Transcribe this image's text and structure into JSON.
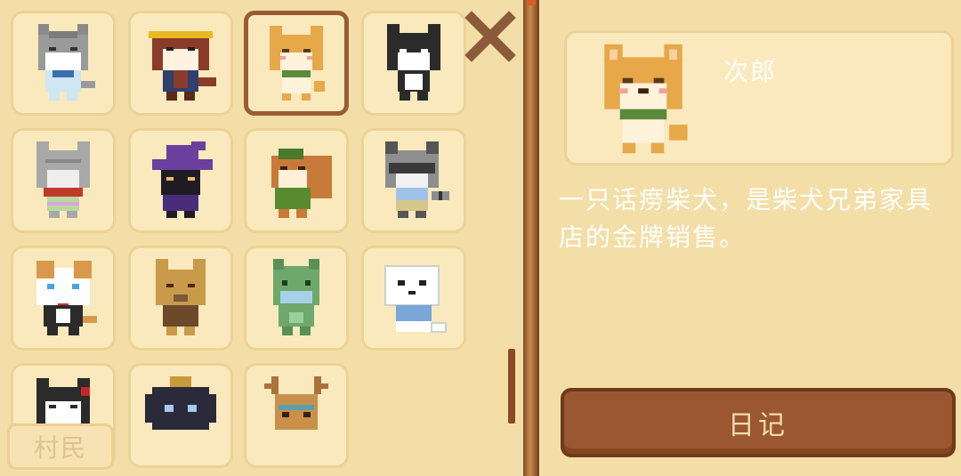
{
  "villagers": [
    {
      "id": "gray-tabby-cat",
      "selected": false
    },
    {
      "id": "red-panda",
      "selected": false
    },
    {
      "id": "shiba-jiro",
      "selected": true
    },
    {
      "id": "black-white-cat",
      "selected": false
    },
    {
      "id": "gray-cat-scarf",
      "selected": false
    },
    {
      "id": "black-cat-witch",
      "selected": false
    },
    {
      "id": "squirrel",
      "selected": false
    },
    {
      "id": "raccoon",
      "selected": false
    },
    {
      "id": "calico-cat",
      "selected": false
    },
    {
      "id": "fox",
      "selected": false
    },
    {
      "id": "green-dinosaur",
      "selected": false
    },
    {
      "id": "seal",
      "selected": false
    },
    {
      "id": "tuxedo-cat",
      "selected": false
    },
    {
      "id": "black-bunny",
      "selected": false
    },
    {
      "id": "deer",
      "selected": false
    }
  ],
  "tabs": {
    "villager_label": "村民"
  },
  "detail": {
    "name": "次郎",
    "description": "一只话痨柴犬，是柴犬兄弟家具店的金牌销售。",
    "diary_label": "日记"
  },
  "icons": {
    "close": "close-x-icon"
  },
  "colors": {
    "panel": "#f3dea7",
    "frame": "#9b5b34",
    "button": "#9a5731"
  }
}
